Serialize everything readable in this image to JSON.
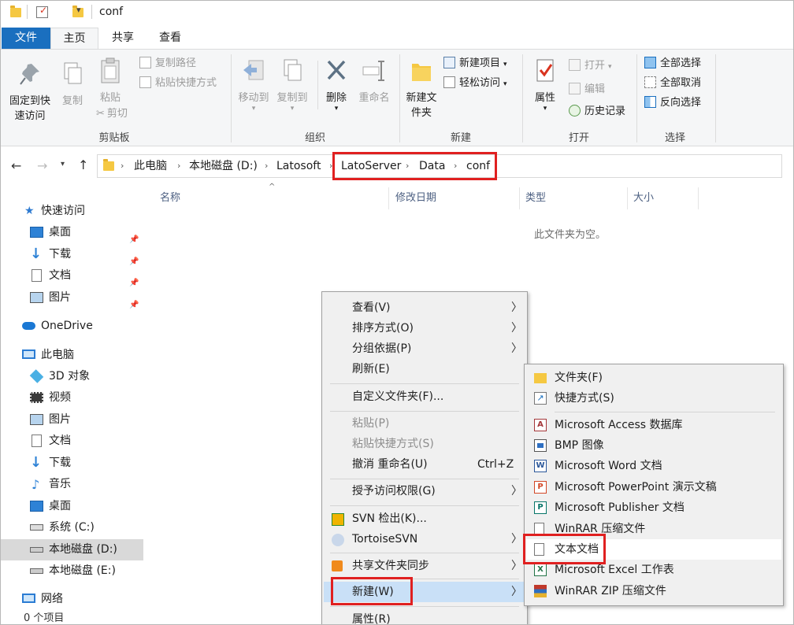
{
  "titlebar": {
    "title": "conf"
  },
  "tabs": {
    "file": "文件",
    "home": "主页",
    "share": "共享",
    "view": "查看"
  },
  "ribbon": {
    "clipboard": {
      "label": "剪贴板",
      "pin_quick": "固定到快速访问",
      "copy": "复制",
      "paste": "粘贴",
      "copy_path": "复制路径",
      "paste_shortcut": "粘贴快捷方式",
      "cut": "剪切"
    },
    "organize": {
      "label": "组织",
      "move_to": "移动到",
      "copy_to": "复制到",
      "delete": "删除",
      "rename": "重命名"
    },
    "new": {
      "label": "新建",
      "new_folder": "新建文件夹",
      "new_item": "新建项目",
      "easy_access": "轻松访问"
    },
    "open": {
      "label": "打开",
      "properties": "属性",
      "open": "打开",
      "edit": "编辑",
      "history": "历史记录"
    },
    "select": {
      "label": "选择",
      "select_all": "全部选择",
      "select_none": "全部取消",
      "invert": "反向选择"
    }
  },
  "address": {
    "crumbs": [
      "此电脑",
      "本地磁盘 (D:)",
      "Latosoft",
      "LatoServer",
      "Data",
      "conf"
    ]
  },
  "columns": {
    "name": "名称",
    "modified": "修改日期",
    "type": "类型",
    "size": "大小"
  },
  "empty_text": "此文件夹为空。",
  "nav": {
    "quick_access": "快速访问",
    "desktop": "桌面",
    "downloads": "下载",
    "documents": "文档",
    "pictures": "图片",
    "onedrive": "OneDrive",
    "this_pc": "此电脑",
    "objects3d": "3D 对象",
    "videos": "视频",
    "pictures2": "图片",
    "documents2": "文档",
    "downloads2": "下载",
    "music": "音乐",
    "desktop2": "桌面",
    "drive_c": "系统 (C:)",
    "drive_d": "本地磁盘 (D:)",
    "drive_e": "本地磁盘 (E:)",
    "network": "网络"
  },
  "status": {
    "count": "0 个项目"
  },
  "context_menu": {
    "view": "查看(V)",
    "sort": "排序方式(O)",
    "group": "分组依据(P)",
    "refresh": "刷新(E)",
    "customize": "自定义文件夹(F)...",
    "paste": "粘贴(P)",
    "paste_shortcut": "粘贴快捷方式(S)",
    "undo": "撤消 重命名(U)",
    "undo_shortcut": "Ctrl+Z",
    "grant": "授予访问权限(G)",
    "svn_checkout": "SVN 检出(K)...",
    "tortoise": "TortoiseSVN",
    "share_sync": "共享文件夹同步",
    "new": "新建(W)",
    "properties": "属性(R)"
  },
  "submenu": {
    "folder": "文件夹(F)",
    "shortcut": "快捷方式(S)",
    "access": "Microsoft Access 数据库",
    "bmp": "BMP 图像",
    "word": "Microsoft Word 文档",
    "ppt": "Microsoft PowerPoint 演示文稿",
    "publisher": "Microsoft Publisher 文档",
    "winrar": "WinRAR 压缩文件",
    "text": "文本文档",
    "excel": "Microsoft Excel 工作表",
    "winrar_zip": "WinRAR ZIP 压缩文件"
  }
}
